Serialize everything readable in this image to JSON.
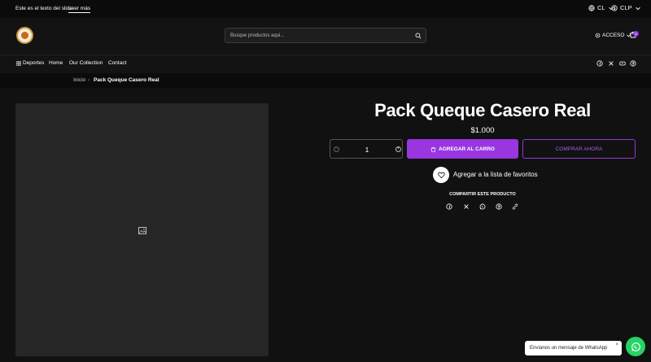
{
  "announcement": {
    "text": "Este es el texto del slide",
    "link": "Leer más"
  },
  "locale": {
    "country": "CL",
    "currency": "CLP"
  },
  "search": {
    "placeholder": "Busque productos aqui..."
  },
  "header": {
    "access_label": "ACCESO",
    "cart_count": "1"
  },
  "nav": {
    "items": [
      "Deportes",
      "Home",
      "Our Collection",
      "Contact"
    ]
  },
  "breadcrumb": {
    "home": "Inicio",
    "current": "Pack Queque Casero Real"
  },
  "product": {
    "title": "Pack Queque Casero Real",
    "price": "$1.000",
    "quantity": "1",
    "add_to_cart": "AGREGAR AL CARRO",
    "buy_now": "COMPRAR AHORA",
    "wishlist": "Agregar a la lista de favoritos",
    "share_label": "COMPARTIR ESTE PRODUCTO"
  },
  "whatsapp": {
    "message": "Envíanos un mensaje de WhatsApp",
    "close": "×"
  },
  "colors": {
    "accent": "#9a36e0",
    "whatsapp": "#25d366"
  }
}
